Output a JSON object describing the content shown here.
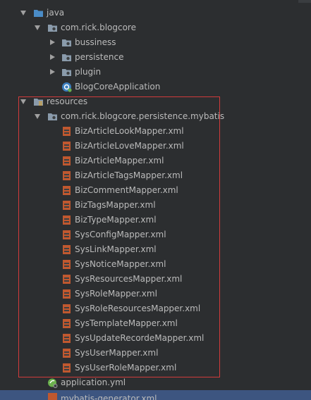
{
  "tree": {
    "java": {
      "label": "java",
      "icon": "source-folder-icon"
    },
    "package_main": {
      "label": "com.rick.blogcore",
      "icon": "package-icon"
    },
    "bussiness": {
      "label": "bussiness",
      "icon": "folder-icon"
    },
    "persistence": {
      "label": "persistence",
      "icon": "folder-icon"
    },
    "plugin": {
      "label": "plugin",
      "icon": "folder-icon"
    },
    "app_class": {
      "label": "BlogCoreApplication",
      "icon": "spring-class-icon"
    },
    "resources": {
      "label": "resources",
      "icon": "resources-folder-icon"
    },
    "mybatis_package": {
      "label": "com.rick.blogcore.persistence.mybatis",
      "icon": "package-icon"
    },
    "xml_files": [
      "BizArticleLookMapper.xml",
      "BizArticleLoveMapper.xml",
      "BizArticleMapper.xml",
      "BizArticleTagsMapper.xml",
      "BizCommentMapper.xml",
      "BizTagsMapper.xml",
      "BizTypeMapper.xml",
      "SysConfigMapper.xml",
      "SysLinkMapper.xml",
      "SysNoticeMapper.xml",
      "SysResourcesMapper.xml",
      "SysRoleMapper.xml",
      "SysRoleResourcesMapper.xml",
      "SysTemplateMapper.xml",
      "SysUpdateRecordeMapper.xml",
      "SysUserMapper.xml",
      "SysUserRoleMapper.xml"
    ],
    "application_yml": {
      "label": "application.yml",
      "icon": "spring-config-icon"
    },
    "generator_xml": {
      "label": "mybatis-generator.xml",
      "icon": "xml-file-icon"
    }
  },
  "colors": {
    "background": "#2c2e30",
    "text": "#bbbbbb",
    "highlight_border": "#d23b3b",
    "selection": "#3d5580",
    "folder": "#8a9bab",
    "source_folder": "#4a8cc7",
    "xml_icon": "#c0582f"
  }
}
